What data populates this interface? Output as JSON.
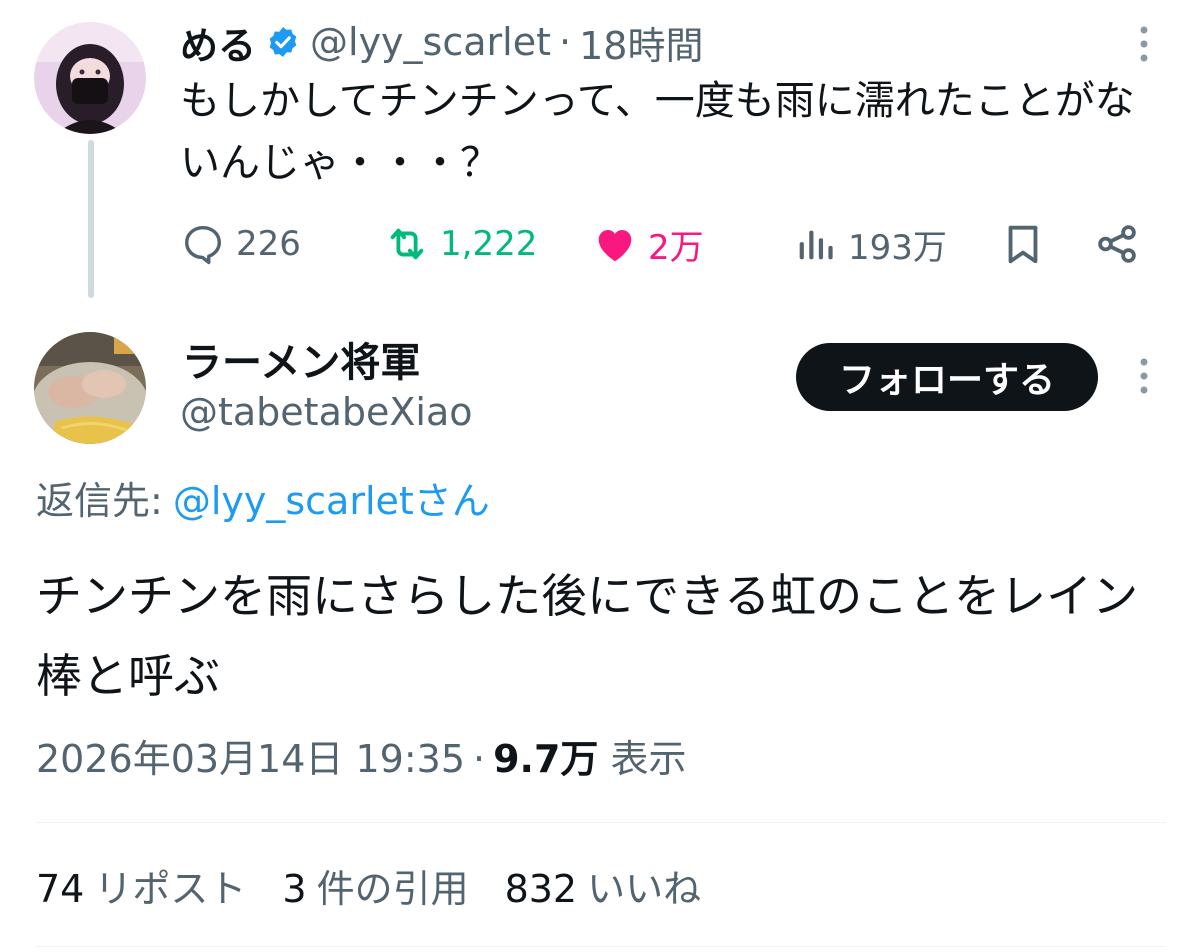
{
  "parent_tweet": {
    "display_name": "める",
    "handle": "@lyy_scarlet",
    "separator": "·",
    "time": "18時間",
    "text": "もしかしてチンチンって、一度も雨に濡れたことがないんじゃ・・・？",
    "actions": {
      "replies": "226",
      "reposts": "1,222",
      "likes": "2万",
      "views": "193万"
    },
    "icons": [
      "verified-badge-icon",
      "more-icon",
      "reply-icon",
      "repost-icon",
      "heart-icon",
      "views-icon",
      "bookmark-icon",
      "share-icon"
    ]
  },
  "main_tweet": {
    "display_name": "ラーメン将軍",
    "handle": "@tabetabeXiao",
    "follow_label": "フォローする",
    "reply_to_label": "返信先:",
    "reply_to_user": "@lyy_scarletさん",
    "text": "チンチンを雨にさらした後にできる虹のことをレイン棒と呼ぶ",
    "timestamp": "2026年03月14日 19:35",
    "separator": "·",
    "views_count": "9.7万",
    "views_label": "表示",
    "stats": {
      "reposts_count": "74",
      "reposts_label": "リポスト",
      "quotes_count": "3",
      "quotes_label": "件の引用",
      "likes_count": "832",
      "likes_label": "いいね"
    }
  },
  "colors": {
    "text_primary": "#0f1419",
    "text_secondary": "#536471",
    "link": "#1d9bf0",
    "repost_green": "#00ba7c",
    "like_pink": "#f91880",
    "verified_blue": "#1d9bf0",
    "follow_button_bg": "#0f1419",
    "thread_line": "#cfd9de"
  }
}
